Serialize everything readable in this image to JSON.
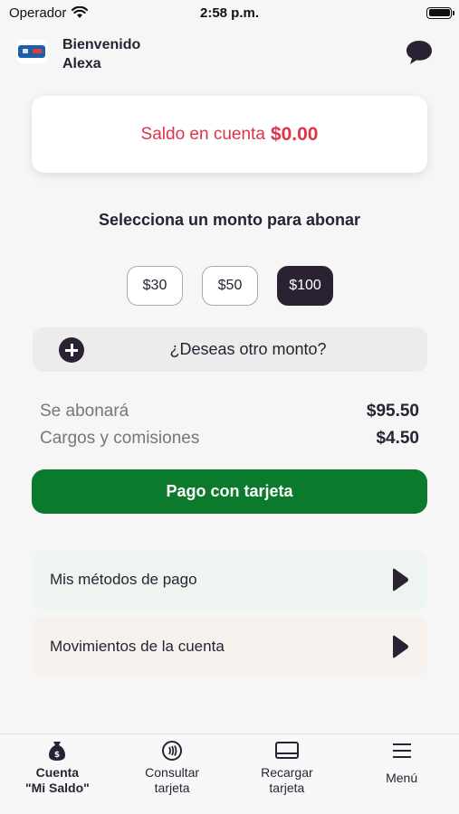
{
  "status_bar": {
    "carrier": "Operador",
    "time": "2:58 p.m."
  },
  "header": {
    "greeting": "Bienvenido",
    "user_name": "Alexa"
  },
  "balance": {
    "label": "Saldo en cuenta",
    "amount": "$0.00"
  },
  "amount_section": {
    "title": "Selecciona un monto para abonar",
    "options": [
      {
        "label": "$30",
        "selected": false
      },
      {
        "label": "$50",
        "selected": false
      },
      {
        "label": "$100",
        "selected": true
      }
    ],
    "other_amount_label": "¿Deseas otro monto?"
  },
  "summary": {
    "credit_label": "Se abonará",
    "credit_value": "$95.50",
    "fees_label": "Cargos y comisiones",
    "fees_value": "$4.50"
  },
  "pay_button": {
    "label": "Pago con tarjeta"
  },
  "links": {
    "payment_methods": "Mis métodos de pago",
    "account_movements": "Movimientos de la cuenta"
  },
  "tab_bar": {
    "tabs": [
      {
        "label": "Cuenta\n\"Mi Saldo\"",
        "icon": "money-bag-icon",
        "active": true
      },
      {
        "label": "Consultar\ntarjeta",
        "icon": "nfc-icon",
        "active": false
      },
      {
        "label": "Recargar\ntarjeta",
        "icon": "card-reader-icon",
        "active": false
      },
      {
        "label": "Menú",
        "icon": "hamburger-menu-icon",
        "active": false
      }
    ]
  },
  "colors": {
    "primary_dark": "#2a2233",
    "accent_red": "#e0334a",
    "pay_green": "#0b7a2c"
  }
}
